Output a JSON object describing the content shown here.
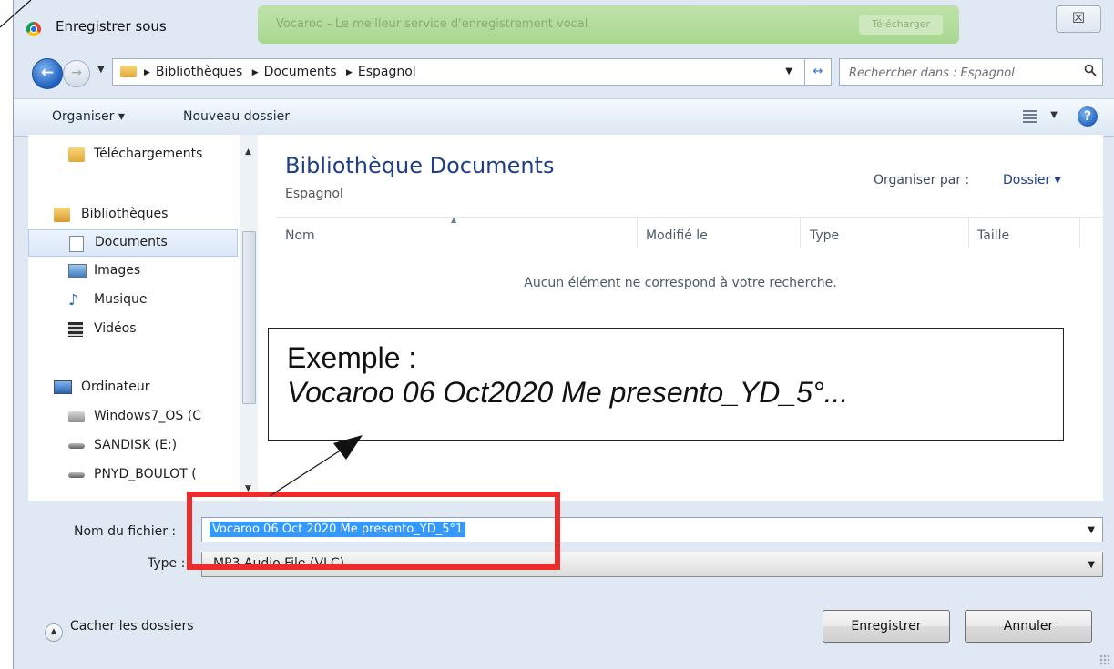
{
  "window": {
    "title": "Enregistrer sous",
    "close_label": "☒",
    "background_banner": "Vocaroo - Le meilleur service d'enregistrement vocal",
    "background_banner_button": "Télécharger"
  },
  "address": {
    "breadcrumb": [
      "Bibliothèques",
      "Documents",
      "Espagnol"
    ],
    "search_placeholder": "Rechercher dans : Espagnol"
  },
  "toolbar": {
    "organize_label": "Organiser ▾",
    "new_folder_label": "Nouveau dossier"
  },
  "navigation": {
    "items": [
      {
        "label": "Téléchargements",
        "icon": "downloads-folder-icon"
      },
      {
        "label": "Bibliothèques",
        "icon": "libraries-icon"
      },
      {
        "label": "Documents",
        "icon": "documents-icon",
        "selected": true
      },
      {
        "label": "Images",
        "icon": "images-icon"
      },
      {
        "label": "Musique",
        "icon": "music-icon"
      },
      {
        "label": "Vidéos",
        "icon": "videos-icon"
      },
      {
        "label": "Ordinateur",
        "icon": "computer-icon"
      },
      {
        "label": "Windows7_OS (C",
        "icon": "drive-c-icon"
      },
      {
        "label": "SANDISK (E:)",
        "icon": "removable-drive-icon"
      },
      {
        "label": "PNYD_BOULOT (",
        "icon": "removable-drive-icon"
      }
    ]
  },
  "main": {
    "title": "Bibliothèque Documents",
    "subtitle": "Espagnol",
    "arrange_label": "Organiser par :",
    "arrange_value": "Dossier ▾",
    "columns": [
      "Nom",
      "Modifié le",
      "Type",
      "Taille"
    ],
    "empty_message": "Aucun élément ne correspond à votre recherche."
  },
  "callout": {
    "line1": "Exemple :",
    "line2": "Vocaroo 06 Oct2020 Me presento_YD_5°..."
  },
  "form": {
    "filename_label": "Nom du fichier :",
    "filename_value": "Vocaroo 06 Oct 2020 Me presento_YD_5°1",
    "type_label": "Type :",
    "type_value": "MP3 Audio File (VLC)"
  },
  "footer": {
    "hide_folders_label": "Cacher les dossiers",
    "save_label": "Enregistrer",
    "cancel_label": "Annuler"
  },
  "colors": {
    "highlight_red": "#ee2b2b",
    "selection_blue": "#3399ff",
    "library_title_blue": "#1e3f87",
    "window_frame": "#dfe8f3"
  }
}
